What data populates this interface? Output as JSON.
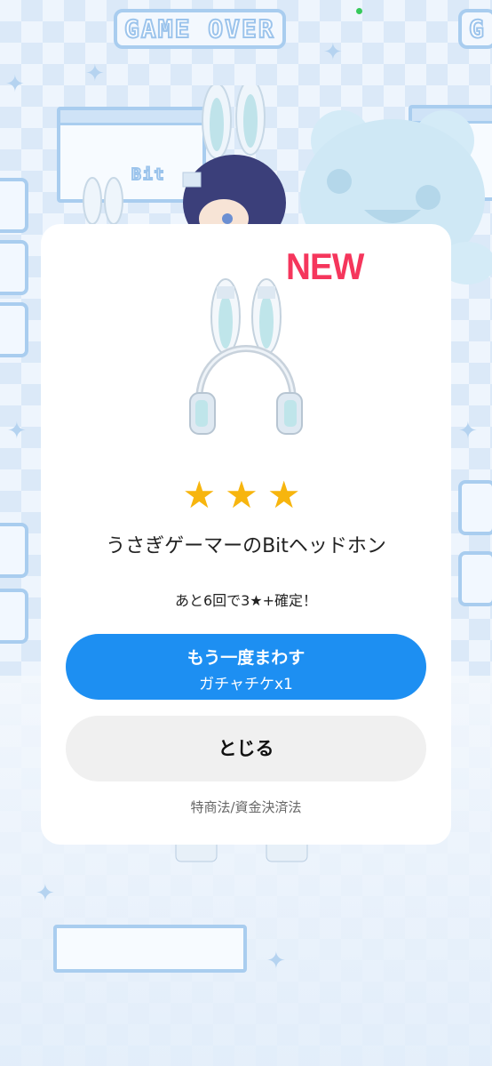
{
  "background": {
    "banner_text": "GAME OVER",
    "logo_text": "Bit"
  },
  "modal": {
    "badge": "NEW",
    "rarity_stars": "★★★",
    "rarity": 3,
    "item_name": "うさぎゲーマーのBitヘッドホン",
    "pity_notice": "あと6回で3★+確定！",
    "spin_again": {
      "label": "もう一度まわす",
      "cost": "ガチャチケx1"
    },
    "close_label": "とじる",
    "legal_link": "特商法/資金決済法"
  },
  "colors": {
    "accent": "#1d8ff2",
    "new_badge": "#f5365c",
    "star": "#f7b50e",
    "status_dot": "#36c95b"
  }
}
